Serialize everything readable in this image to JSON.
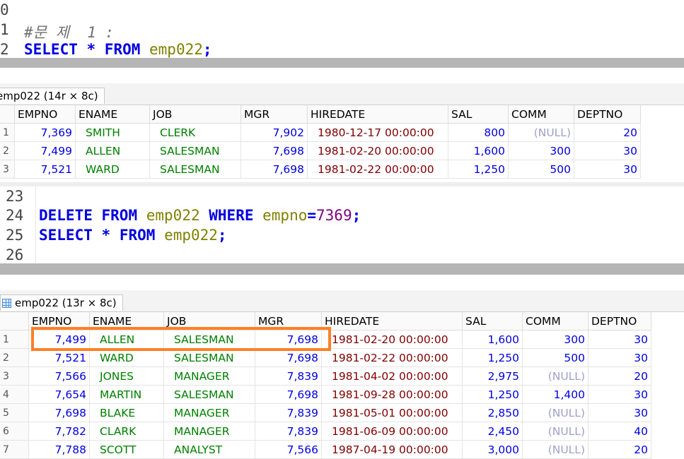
{
  "editor1": {
    "lines": [
      {
        "num": "0",
        "text": ""
      },
      {
        "num": "1",
        "text": "#문 제  1 :"
      },
      {
        "num": "2",
        "tokens": [
          "SELECT",
          " * ",
          "FROM",
          " emp022",
          ";"
        ]
      }
    ]
  },
  "result1": {
    "tab_label": "emp022 (14r × 8c)",
    "columns": [
      "EMPNO",
      "ENAME",
      "JOB",
      "MGR",
      "HIREDATE",
      "SAL",
      "COMM",
      "DEPTNO"
    ],
    "rows": [
      [
        "1",
        "7,369",
        "SMITH",
        "CLERK",
        "7,902",
        "1980-12-17 00:00:00",
        "800",
        "(NULL)",
        "20"
      ],
      [
        "2",
        "7,499",
        "ALLEN",
        "SALESMAN",
        "7,698",
        "1981-02-20 00:00:00",
        "1,600",
        "300",
        "30"
      ],
      [
        "3",
        "7,521",
        "WARD",
        "SALESMAN",
        "7,698",
        "1981-02-22 00:00:00",
        "1,250",
        "500",
        "30"
      ]
    ]
  },
  "editor2": {
    "line_numbers": [
      "23",
      "24",
      "25",
      "26"
    ],
    "delete_stmt": {
      "kw1": "DELETE",
      "kw2": "FROM",
      "table": "emp022",
      "kw3": "WHERE",
      "col": "empno",
      "op": "=",
      "val": "7369",
      "end": ";"
    },
    "select_stmt": {
      "kw1": "SELECT",
      "star": "*",
      "kw2": "FROM",
      "table": "emp022",
      "end": ";"
    }
  },
  "result2": {
    "tab_label": "emp022 (13r × 8c)",
    "columns": [
      "EMPNO",
      "ENAME",
      "JOB",
      "MGR",
      "HIREDATE",
      "SAL",
      "COMM",
      "DEPTNO"
    ],
    "rows": [
      [
        "1",
        "7,499",
        "ALLEN",
        "SALESMAN",
        "7,698",
        "1981-02-20 00:00:00",
        "1,600",
        "300",
        "30"
      ],
      [
        "2",
        "7,521",
        "WARD",
        "SALESMAN",
        "7,698",
        "1981-02-22 00:00:00",
        "1,250",
        "500",
        "30"
      ],
      [
        "3",
        "7,566",
        "JONES",
        "MANAGER",
        "7,839",
        "1981-04-02 00:00:00",
        "2,975",
        "(NULL)",
        "20"
      ],
      [
        "4",
        "7,654",
        "MARTIN",
        "SALESMAN",
        "7,698",
        "1981-09-28 00:00:00",
        "1,250",
        "1,400",
        "30"
      ],
      [
        "5",
        "7,698",
        "BLAKE",
        "MANAGER",
        "7,839",
        "1981-05-01 00:00:00",
        "2,850",
        "(NULL)",
        "30"
      ],
      [
        "6",
        "7,782",
        "CLARK",
        "MANAGER",
        "7,839",
        "1981-06-09 00:00:00",
        "2,450",
        "(NULL)",
        "40"
      ],
      [
        "7",
        "7,788",
        "SCOTT",
        "ANALYST",
        "7,566",
        "1987-04-19 00:00:00",
        "3,000",
        "(NULL)",
        "20"
      ]
    ]
  },
  "colors": {
    "keyword": "#0000e0",
    "identifier": "#808000",
    "number": "#800080",
    "highlight": "#ff7f27"
  }
}
